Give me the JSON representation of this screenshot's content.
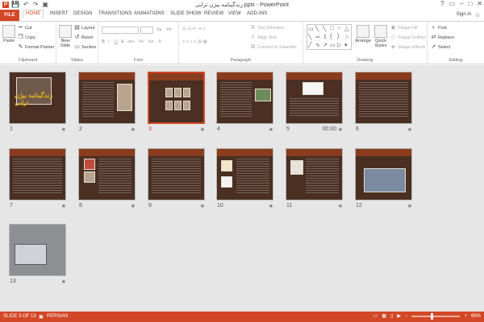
{
  "titlebar": {
    "app_icon": "P",
    "title": "زندگینامه بیژن ترابی.pptx - PowerPoint",
    "window_controls": [
      "?",
      "▭",
      "–",
      "□",
      "✕"
    ],
    "qat_icons": [
      "save-icon",
      "undo-icon",
      "redo-icon",
      "present-icon"
    ]
  },
  "tabs": {
    "file": "FILE",
    "items": [
      "HOME",
      "INSERT",
      "DESIGN",
      "TRANSITIONS",
      "ANIMATIONS",
      "SLIDE SHOW",
      "REVIEW",
      "VIEW",
      "ADD-INS"
    ],
    "active": "HOME",
    "sign_in": "Sign in"
  },
  "ribbon": {
    "clipboard": {
      "label": "Clipboard",
      "paste": "Paste",
      "cut": "Cut",
      "copy": "Copy",
      "format_painter": "Format Painter"
    },
    "slides": {
      "label": "Slides",
      "new_slide": "New Slide",
      "layout": "Layout",
      "reset": "Reset",
      "section": "Section"
    },
    "font": {
      "label": "Font",
      "font_name": "",
      "font_size": "",
      "bold": "B",
      "italic": "I",
      "underline": "U",
      "strike": "S",
      "shadow": "abe",
      "char_spacing": "AV",
      "case": "Aa",
      "color": "A"
    },
    "paragraph": {
      "label": "Paragraph",
      "text_direction": "Text Direction",
      "align_text": "Align Text",
      "convert_smartart": "Convert to SmartArt"
    },
    "drawing": {
      "label": "Drawing",
      "arrange": "Arrange",
      "quick_styles": "Quick Styles",
      "shape_fill": "Shape Fill",
      "shape_outline": "Shape Outline",
      "shape_effects": "Shape Effects"
    },
    "editing": {
      "label": "Editing",
      "find": "Find",
      "replace": "Replace",
      "select": "Select"
    }
  },
  "slides": [
    {
      "number": "1",
      "timing": ""
    },
    {
      "number": "2",
      "timing": ""
    },
    {
      "number": "3",
      "timing": ""
    },
    {
      "number": "4",
      "timing": ""
    },
    {
      "number": "5",
      "timing": "00:00"
    },
    {
      "number": "6",
      "timing": ""
    },
    {
      "number": "7",
      "timing": ""
    },
    {
      "number": "8",
      "timing": ""
    },
    {
      "number": "9",
      "timing": ""
    },
    {
      "number": "10",
      "timing": ""
    },
    {
      "number": "11",
      "timing": ""
    },
    {
      "number": "12",
      "timing": ""
    },
    {
      "number": "13",
      "timing": ""
    }
  ],
  "slide1_title": "زندگینامه بیژن ترابی",
  "selected_slide": 3,
  "statusbar": {
    "slide_info": "SLIDE 3 OF 13",
    "language": "PERSIAN",
    "zoom": "66%"
  },
  "colors": {
    "accent": "#d24726",
    "thumb_bg": "#4a2f22",
    "sorter_bg": "#e6e6e6"
  }
}
